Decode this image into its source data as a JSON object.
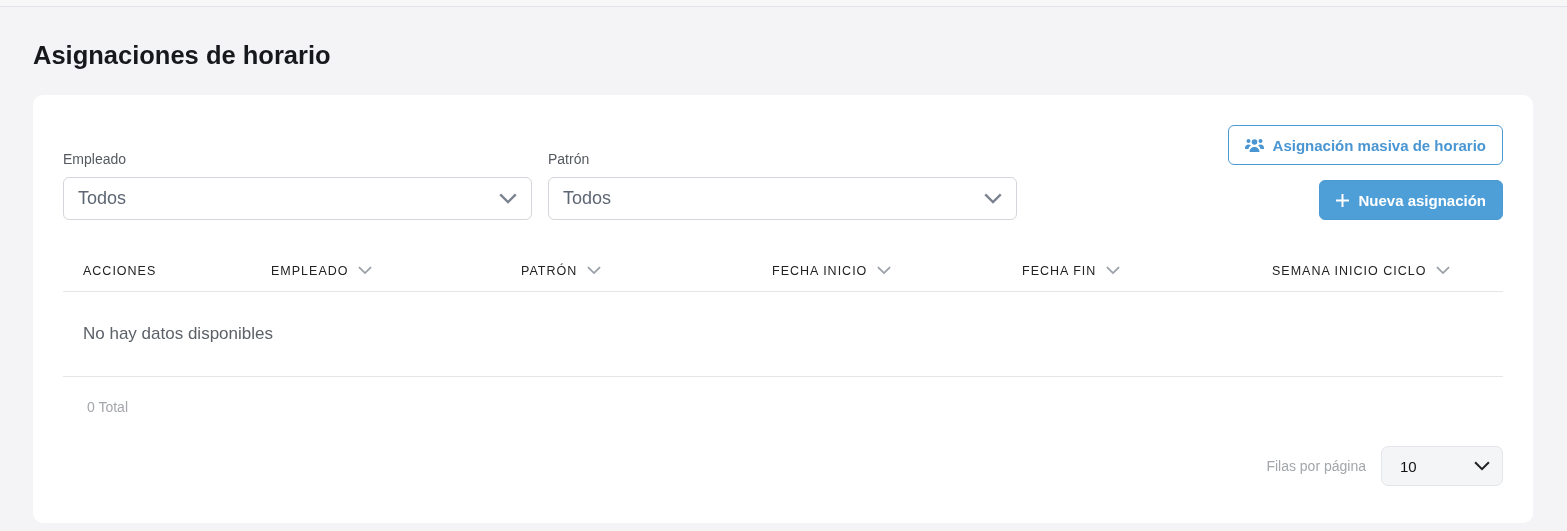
{
  "page": {
    "title": "Asignaciones de horario"
  },
  "filters": [
    {
      "label": "Empleado",
      "value": "Todos"
    },
    {
      "label": "Patrón",
      "value": "Todos"
    }
  ],
  "actions": [
    {
      "kind": "outline",
      "label": "Asignación masiva de horario"
    },
    {
      "kind": "primary",
      "label": "Nueva asignación"
    }
  ],
  "table": {
    "columns": [
      {
        "label": "ACCIONES",
        "sortable": false
      },
      {
        "label": "EMPLEADO",
        "sortable": true
      },
      {
        "label": "PATRÓN",
        "sortable": true
      },
      {
        "label": "FECHA INICIO",
        "sortable": true
      },
      {
        "label": "FECHA FIN",
        "sortable": true
      },
      {
        "label": "SEMANA INICIO CICLO",
        "sortable": true
      }
    ],
    "empty_message": "No hay datos disponibles",
    "total": "0 Total"
  },
  "pagination": {
    "label": "Filas por página",
    "value": "10"
  }
}
